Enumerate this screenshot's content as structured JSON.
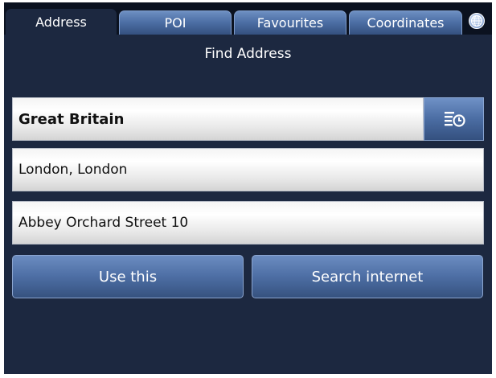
{
  "tabs": [
    {
      "label": "Address",
      "active": true
    },
    {
      "label": "POI",
      "active": false
    },
    {
      "label": "Favourites",
      "active": false
    },
    {
      "label": "Coordinates",
      "active": false
    }
  ],
  "header": {
    "title": "Find Address",
    "globe_icon": "globe-icon"
  },
  "form": {
    "country": "Great Britain",
    "country_button_icon": "list-select-icon",
    "city": "London, London",
    "street": "Abbey Orchard Street 10"
  },
  "actions": {
    "use_this": "Use this",
    "search_internet": "Search internet"
  },
  "colors": {
    "background": "#1c2840",
    "tab": "#4c6ea4",
    "button": "#4d6ea4",
    "field": "#ececec"
  }
}
